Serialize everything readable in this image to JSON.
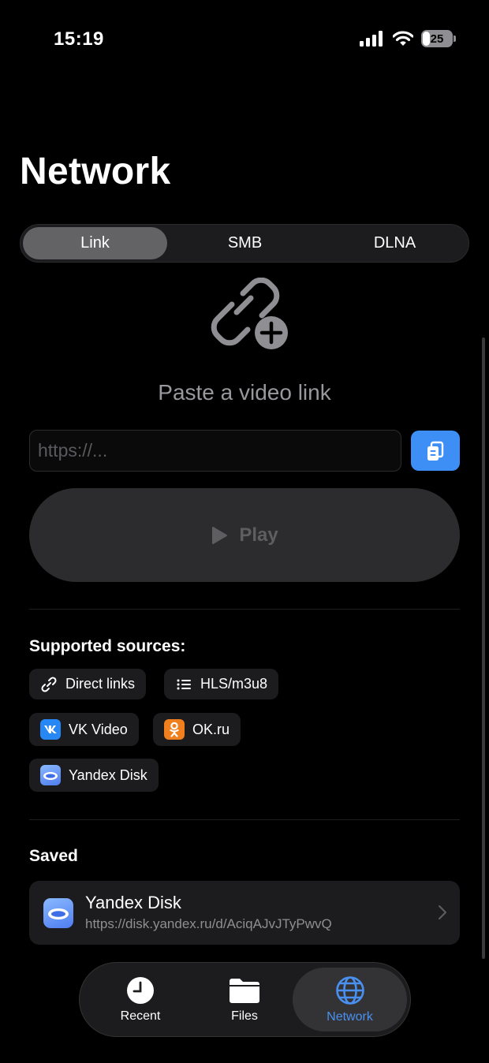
{
  "status_bar": {
    "time": "15:19",
    "battery_level": "25",
    "icons": [
      "signal-icon",
      "wifi-icon",
      "battery-icon"
    ]
  },
  "page": {
    "title": "Network"
  },
  "segments": {
    "items": [
      "Link",
      "SMB",
      "DLNA"
    ],
    "selected": "Link"
  },
  "link_panel": {
    "hero_icon": "link-plus-icon",
    "title": "Paste a video link",
    "url_input": {
      "placeholder": "https://...",
      "value": ""
    },
    "paste_icon": "clipboard-icon",
    "play_label": "Play"
  },
  "supported_sources": {
    "heading": "Supported sources:",
    "items": [
      {
        "label": "Direct links",
        "icon": "link-icon"
      },
      {
        "label": "HLS/m3u8",
        "icon": "list-icon"
      },
      {
        "label": "VK Video",
        "icon": "vk-icon"
      },
      {
        "label": "OK.ru",
        "icon": "ok-icon"
      },
      {
        "label": "Yandex Disk",
        "icon": "yandex-disk-icon"
      }
    ]
  },
  "saved": {
    "heading": "Saved",
    "items": [
      {
        "title": "Yandex Disk",
        "url": "https://disk.yandex.ru/d/AciqAJvJTyPwvQ",
        "icon": "yandex-disk-icon"
      }
    ]
  },
  "tab_bar": {
    "items": [
      {
        "label": "Recent",
        "icon": "clock-icon"
      },
      {
        "label": "Files",
        "icon": "folder-icon"
      },
      {
        "label": "Network",
        "icon": "globe-icon"
      }
    ],
    "selected": "Network"
  },
  "colors": {
    "accent": "#3d8ff5",
    "background": "#000000",
    "surface": "#1c1c1e",
    "vk": "#2787f5",
    "ok": "#f07f1e"
  }
}
